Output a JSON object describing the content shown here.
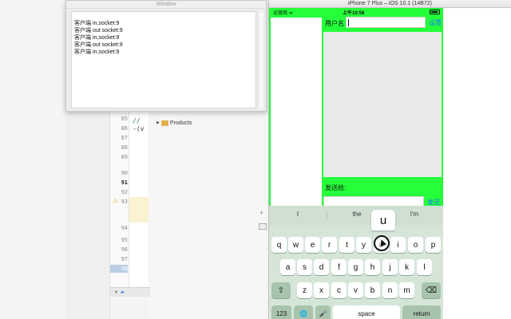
{
  "xcode": {
    "line_numbers": [
      "85",
      "86",
      "87",
      "88",
      "89",
      "90",
      "91",
      "92",
      "93",
      "94",
      "95",
      "96",
      "97",
      "98"
    ],
    "code_comment": "//",
    "code_line": "-(v",
    "warning_symbol": "⚠",
    "nav_item": "Products",
    "plus": "+"
  },
  "window": {
    "title": "Window",
    "log_lines": [
      "客户端 in,socket:9",
      "客户端 out socket:9",
      "客户端 in,socket:9",
      "客户端 out socket:9",
      "客户端 in,socket:9"
    ]
  },
  "simulator": {
    "title": "iPhone 7 Plus – iOS 10.1 (14B72)",
    "status": {
      "carrier": "运营商 ᯤ",
      "time": "上午10:58"
    },
    "username_label": "用户名",
    "username_value": "",
    "set_button": "设置",
    "sendto_label": "发送给:",
    "sendto_value": "",
    "send_button": "发送",
    "screen_color": "#24ff3a"
  },
  "keyboard": {
    "suggestions": [
      "I",
      "the",
      "I'm"
    ],
    "popup_key": "u",
    "row1": [
      "q",
      "w",
      "e",
      "r",
      "t",
      "y",
      "u",
      "i",
      "o",
      "p"
    ],
    "row2": [
      "a",
      "s",
      "d",
      "f",
      "g",
      "h",
      "j",
      "k",
      "l"
    ],
    "row3": [
      "z",
      "x",
      "c",
      "v",
      "b",
      "n",
      "m"
    ],
    "shift_icon": "⇧",
    "delete_icon": "⌫",
    "numbers_key": "123",
    "globe_icon": "🌐",
    "mic_icon": "🎤",
    "space_key": "space",
    "return_key": "return"
  }
}
